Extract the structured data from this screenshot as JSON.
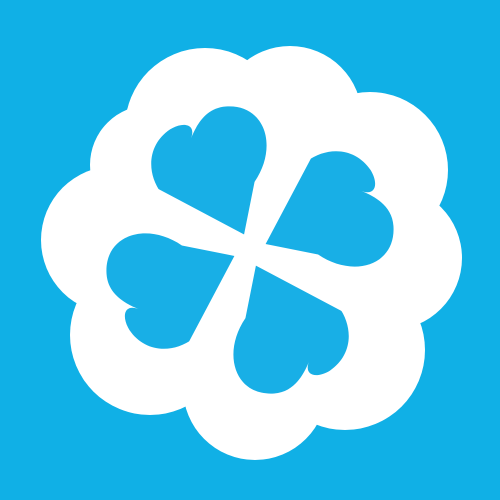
{
  "icon": {
    "name": "four-leaf-clover-logo",
    "colors": {
      "background": "#10b0e6",
      "outline": "#ffffff",
      "leaf_center": "#7ad3f4",
      "leaf_edge": "#18afe6"
    }
  }
}
